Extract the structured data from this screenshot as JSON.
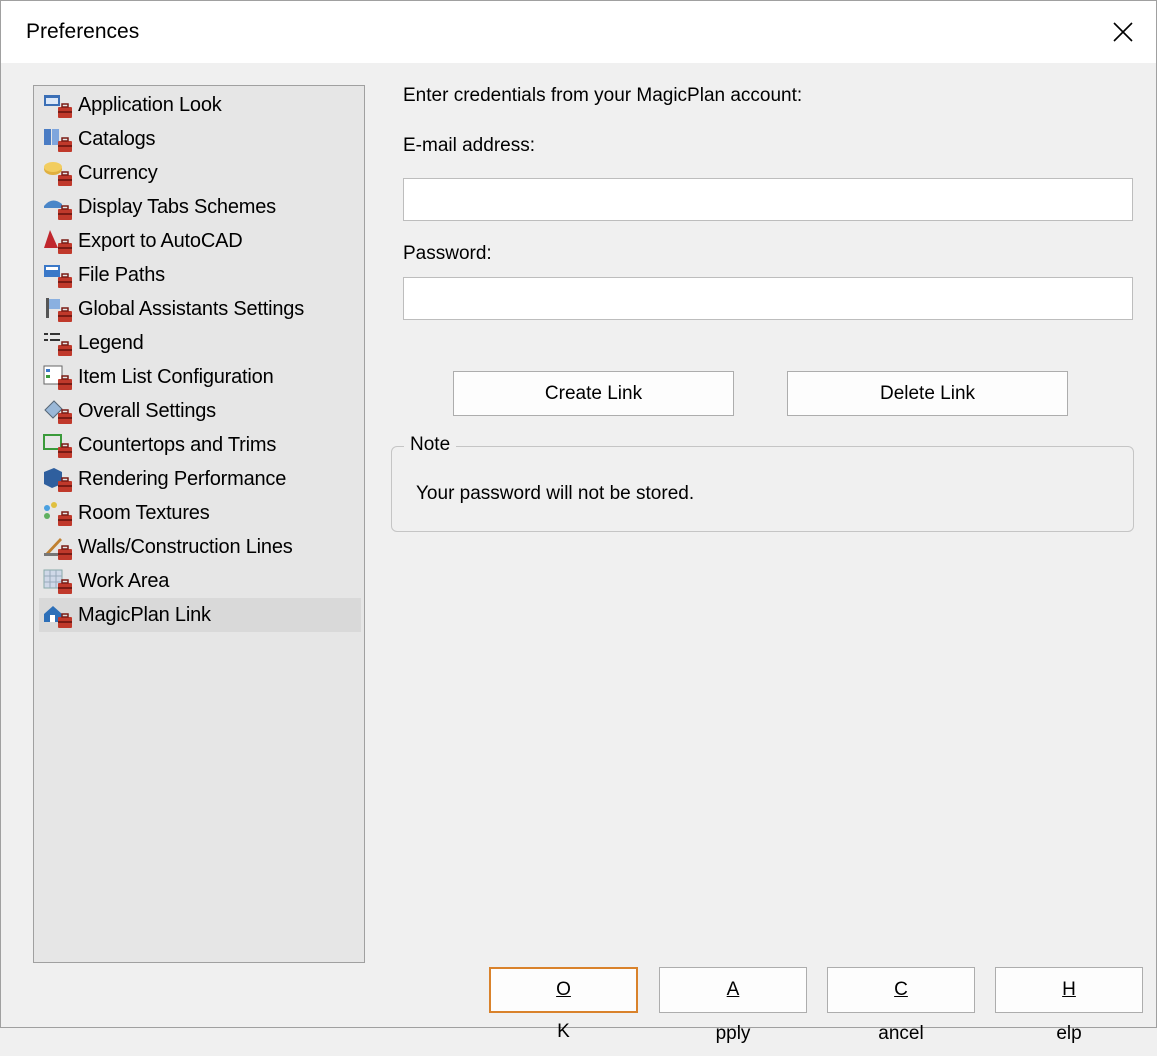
{
  "window": {
    "title": "Preferences"
  },
  "tree": {
    "items": [
      {
        "label": "Application Look",
        "icon": "application-look-icon",
        "selected": false
      },
      {
        "label": "Catalogs",
        "icon": "catalogs-icon",
        "selected": false
      },
      {
        "label": "Currency",
        "icon": "currency-icon",
        "selected": false
      },
      {
        "label": "Display Tabs Schemes",
        "icon": "display-tabs-icon",
        "selected": false
      },
      {
        "label": "Export to AutoCAD",
        "icon": "autocad-icon",
        "selected": false
      },
      {
        "label": "File Paths",
        "icon": "file-paths-icon",
        "selected": false
      },
      {
        "label": "Global Assistants Settings",
        "icon": "assistants-icon",
        "selected": false
      },
      {
        "label": "Legend",
        "icon": "legend-icon",
        "selected": false
      },
      {
        "label": "Item List Configuration",
        "icon": "item-list-icon",
        "selected": false
      },
      {
        "label": "Overall Settings",
        "icon": "overall-settings-icon",
        "selected": false
      },
      {
        "label": "Countertops and Trims",
        "icon": "countertops-icon",
        "selected": false
      },
      {
        "label": "Rendering Performance",
        "icon": "rendering-icon",
        "selected": false
      },
      {
        "label": "Room Textures",
        "icon": "room-textures-icon",
        "selected": false
      },
      {
        "label": "Walls/Construction Lines",
        "icon": "walls-icon",
        "selected": false
      },
      {
        "label": "Work Area",
        "icon": "work-area-icon",
        "selected": false
      },
      {
        "label": "MagicPlan Link",
        "icon": "magicplan-icon",
        "selected": true
      }
    ]
  },
  "panel": {
    "intro": "Enter credentials from your MagicPlan account:",
    "email_label": "E-mail address:",
    "email_value": "",
    "password_label": "Password:",
    "password_value": "",
    "create_link": "Create Link",
    "delete_link": "Delete Link",
    "note_legend": "Note",
    "note_text": "Your password will not be stored."
  },
  "footer": {
    "ok": {
      "accel": "O",
      "rest": "K"
    },
    "apply": {
      "accel": "A",
      "rest": "pply"
    },
    "cancel": {
      "accel": "C",
      "rest": "ancel"
    },
    "help": {
      "accel": "H",
      "rest": "elp"
    }
  },
  "colors": {
    "default_button_border": "#d9822b",
    "selection": "#d9d9d9",
    "toolbox_red": "#c0392b"
  }
}
